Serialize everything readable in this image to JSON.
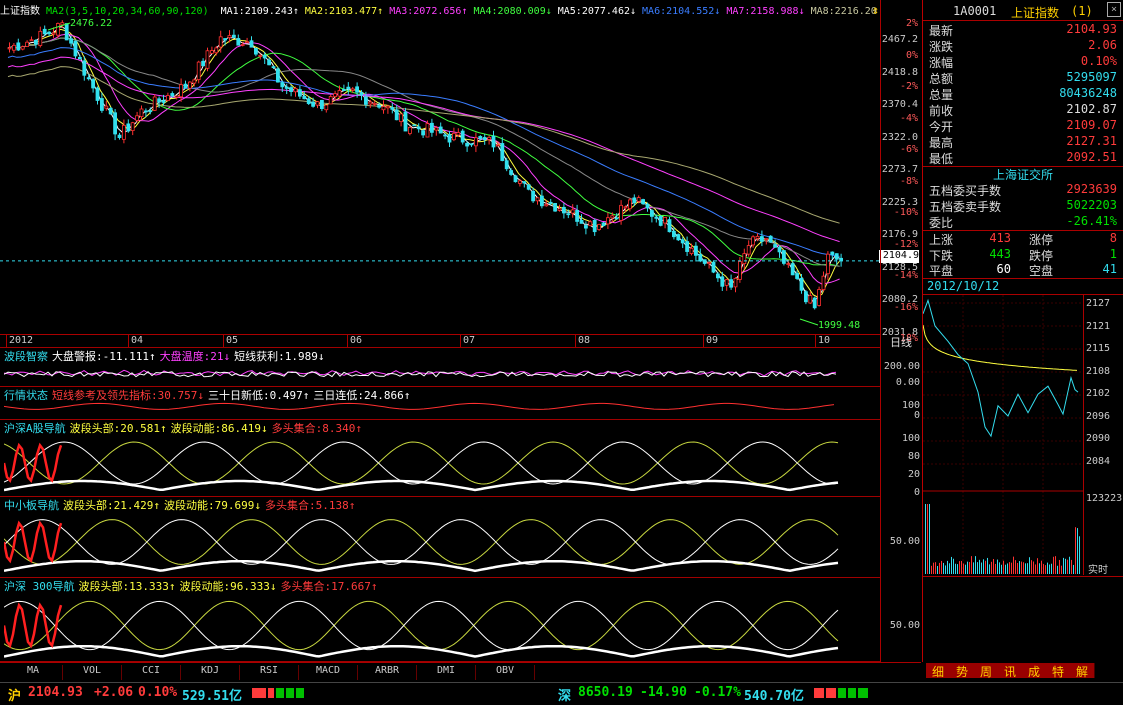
{
  "main_chart": {
    "title": "上证指数",
    "ma_params": "MA2(3,5,10,20,34,60,90,120)",
    "ma_values": [
      {
        "label": "MA1:2109.243",
        "arrow": "↑",
        "color": "#ffffff"
      },
      {
        "label": "MA2:2103.477",
        "arrow": "↑",
        "color": "#ffff40"
      },
      {
        "label": "MA3:2072.656",
        "arrow": "↑",
        "color": "#ff40ff"
      },
      {
        "label": "MA4:2080.009",
        "arrow": "↓",
        "color": "#40ff40"
      },
      {
        "label": "MA5:2077.462",
        "arrow": "↓",
        "color": "#ffffff"
      },
      {
        "label": "MA6:2104.552",
        "arrow": "↓",
        "color": "#3a7dff"
      },
      {
        "label": "MA7:2158.988",
        "arrow": "↓",
        "color": "#ff40ff"
      },
      {
        "label": "MA8:2216.20",
        "arrow": "",
        "color": "#c8c8a0"
      }
    ],
    "high_label": "2476.22",
    "low_label": "1999.48",
    "current_price_tag": "2104.9",
    "price_axis": [
      "2467.2",
      "2418.8",
      "2370.4",
      "2322.0",
      "2273.7",
      "2225.3",
      "2176.9",
      "2128.5",
      "2080.2",
      "2031.8"
    ],
    "pct_axis": [
      "2%",
      "0%",
      "-2%",
      "-4%",
      "-6%",
      "-8%",
      "-10%",
      "-12%",
      "-14%",
      "-16%",
      "-18%"
    ],
    "months": [
      "2012",
      "04",
      "05",
      "06",
      "07",
      "08",
      "09",
      "10"
    ],
    "period_label": "日线"
  },
  "indicators": [
    {
      "name": "波段智察",
      "items": [
        {
          "t": "大盘警报:-11.111",
          "a": "↑",
          "c": "#ffffff"
        },
        {
          "t": "大盘温度:21",
          "a": "↓",
          "c": "#ff40ff"
        },
        {
          "t": "短线获利:1.989",
          "a": "↓",
          "c": "#ffffff"
        }
      ],
      "axis": [
        "200.00",
        "0.00"
      ]
    },
    {
      "name": "行情状态",
      "items": [
        {
          "t": "短线参考及领先指标:30.757",
          "a": "↓",
          "c": "#ff3b3b"
        },
        {
          "t": "三十日新低:0.497",
          "a": "↑",
          "c": "#ffffff"
        },
        {
          "t": "三日连低:24.866",
          "a": "↑",
          "c": "#ffffff"
        }
      ],
      "axis": [
        "100",
        "0"
      ]
    },
    {
      "name": "沪深A股导航",
      "items": [
        {
          "t": "波段头部:20.581",
          "a": "↑",
          "c": "#ffff40"
        },
        {
          "t": "波段动能:86.419",
          "a": "↓",
          "c": "#ffff40"
        },
        {
          "t": "多头集合:8.340",
          "a": "↑",
          "c": "#ff3b3b"
        }
      ],
      "axis": [
        "100",
        "80",
        "20",
        "0"
      ]
    },
    {
      "name": "中小板导航",
      "items": [
        {
          "t": "波段头部:21.429",
          "a": "↑",
          "c": "#ffff40"
        },
        {
          "t": "波段动能:79.699",
          "a": "↓",
          "c": "#ffff40"
        },
        {
          "t": "多头集合:5.138",
          "a": "↑",
          "c": "#ff3b3b"
        }
      ],
      "axis": [
        "50.00"
      ]
    },
    {
      "name": "沪深 300导航",
      "items": [
        {
          "t": "波段头部:13.333",
          "a": "↑",
          "c": "#ffff40"
        },
        {
          "t": "波段动能:96.333",
          "a": "↓",
          "c": "#ffff40"
        },
        {
          "t": "多头集合:17.667",
          "a": "↑",
          "c": "#ff3b3b"
        }
      ],
      "axis": [
        "50.00"
      ]
    }
  ],
  "bottom_tabs": [
    "MA",
    "VOL",
    "CCI",
    "KDJ",
    "RSI",
    "MACD",
    "ARBR",
    "DMI",
    "OBV"
  ],
  "quote": {
    "code": "1A0001",
    "name": "上证指数",
    "suffix": "(1)",
    "rows": [
      {
        "k": "最新",
        "v": "2104.93",
        "c": "#ff3b3b"
      },
      {
        "k": "涨跌",
        "v": "2.06",
        "c": "#ff3b3b"
      },
      {
        "k": "涨幅",
        "v": "0.10%",
        "c": "#ff3b3b"
      },
      {
        "k": "总额",
        "v": "5295097",
        "c": "#33ddee"
      },
      {
        "k": "总量",
        "v": "80436248",
        "c": "#33ddee"
      },
      {
        "k": "前收",
        "v": "2102.87",
        "c": "#dddddd"
      },
      {
        "k": "今开",
        "v": "2109.07",
        "c": "#ff3b3b"
      },
      {
        "k": "最高",
        "v": "2127.31",
        "c": "#ff3b3b"
      },
      {
        "k": "最低",
        "v": "2092.51",
        "c": "#ff3b3b"
      }
    ],
    "exchange": "上海证交所",
    "rows2": [
      {
        "k": "五档委买手数",
        "v": "2923639",
        "c": "#ff3b3b"
      },
      {
        "k": "五档委卖手数",
        "v": "5022203",
        "c": "#00e000"
      },
      {
        "k": "委比",
        "v": "-26.41%",
        "c": "#00e000"
      }
    ],
    "breadth": [
      {
        "k1": "上涨",
        "v1": "413",
        "c1": "#ff3b3b",
        "k2": "涨停",
        "v2": "8",
        "c2": "#ff3b3b"
      },
      {
        "k1": "下跌",
        "v1": "443",
        "c1": "#00e000",
        "k2": "跌停",
        "v2": "1",
        "c2": "#00e000"
      },
      {
        "k1": "平盘",
        "v1": "60",
        "c1": "#ffffff",
        "k2": "空盘",
        "v2": "41",
        "c2": "#33ddee"
      }
    ]
  },
  "intraday": {
    "date": "2012/10/12",
    "axis": [
      "2127",
      "2121",
      "2115",
      "2108",
      "2102",
      "2096",
      "2090",
      "2084"
    ],
    "vol_max": "123223",
    "vol_label": "实时"
  },
  "side_tabs": [
    "细",
    "势",
    "周",
    "讯",
    "成",
    "特",
    "解"
  ],
  "status": {
    "sh_label": "沪",
    "sh_price": "2104.93",
    "sh_change": "+2.06",
    "sh_pct": "0.10%",
    "sh_amount": "529.51亿",
    "sz_label": "深",
    "sz_price": "8650.19",
    "sz_change": "-14.90",
    "sz_pct": "-0.17%",
    "sz_amount": "540.70亿"
  }
}
